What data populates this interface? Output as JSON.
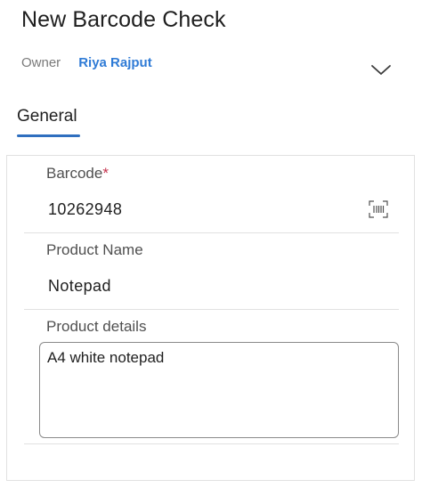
{
  "header": {
    "title": "New Barcode Check",
    "owner_label": "Owner",
    "owner_value": "Riya Rajput",
    "chevron_icon": "chevron-down-icon"
  },
  "tabs": [
    {
      "label": "General",
      "selected": true
    }
  ],
  "form": {
    "barcode": {
      "label": "Barcode",
      "required_mark": "*",
      "value": "10262948",
      "icon": "barcode-scan-icon"
    },
    "product_name": {
      "label": "Product Name",
      "value": "Notepad"
    },
    "product_details": {
      "label": "Product details",
      "value": "A4 white notepad"
    }
  },
  "colors": {
    "accent": "#2f7bd6",
    "tab_underline": "#2f6fbf",
    "required": "#c4314b"
  }
}
